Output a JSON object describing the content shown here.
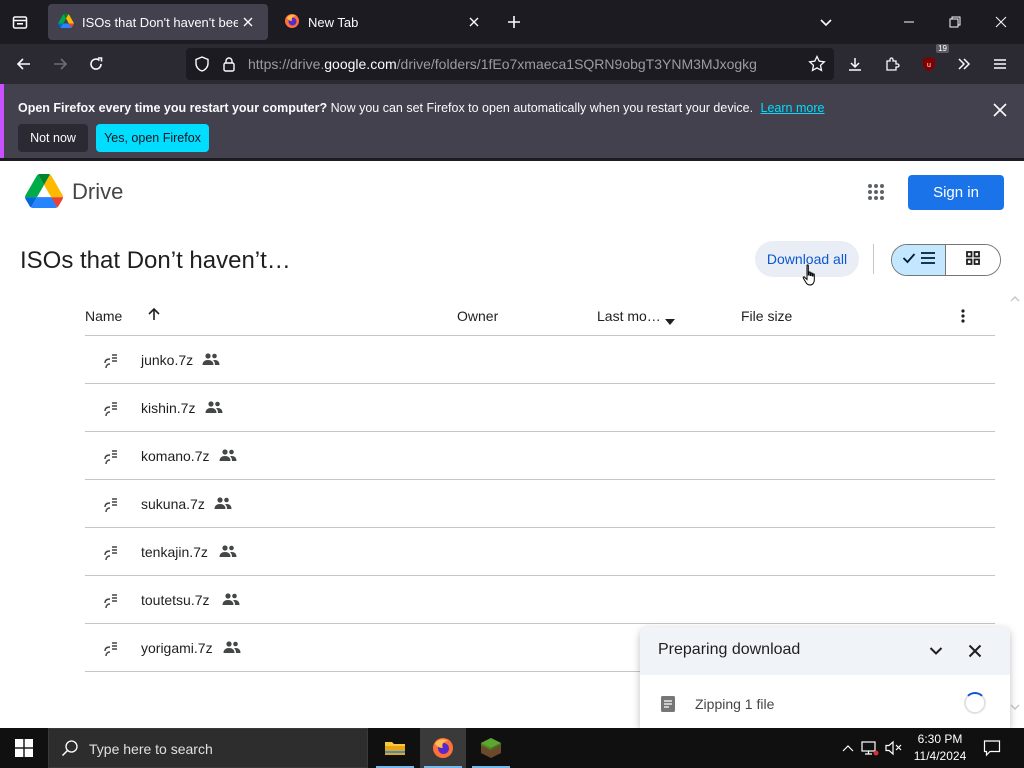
{
  "browser": {
    "tabs": [
      {
        "title": "ISOs that Don't haven't been up",
        "active": true
      },
      {
        "title": "New Tab",
        "active": false
      }
    ],
    "url": {
      "prefix": "https://drive.",
      "host": "google.com",
      "path": "/drive/folders/1fEo7xmaeca1SQRN9obgT3YNM3MJxogkg"
    },
    "extension_badge": "19",
    "notice": {
      "bold": "Open Firefox every time you restart your computer?",
      "text": "Now you can set Firefox to open automatically when you restart your device.",
      "link": "Learn more",
      "not_now": "Not now",
      "yes": "Yes, open Firefox"
    }
  },
  "drive": {
    "brand": "Drive",
    "sign_in": "Sign in",
    "folder_title": "ISOs that Don’t haven’t…",
    "download_all": "Download all",
    "columns": {
      "name": "Name",
      "owner": "Owner",
      "modified": "Last mo…",
      "size": "File size"
    },
    "files": [
      {
        "name": "junko.7z",
        "shared": true
      },
      {
        "name": "kishin.7z",
        "shared": true
      },
      {
        "name": "komano.7z",
        "shared": true
      },
      {
        "name": "sukuna.7z",
        "shared": true
      },
      {
        "name": "tenkajin.7z",
        "shared": true
      },
      {
        "name": "toutetsu.7z",
        "shared": true
      },
      {
        "name": "yorigami.7z",
        "shared": true
      }
    ],
    "download_panel": {
      "title": "Preparing download",
      "item": "Zipping 1 file"
    }
  },
  "taskbar": {
    "search_placeholder": "Type here to search",
    "time": "6:30 PM",
    "date": "11/4/2024"
  },
  "colors": {
    "accent": "#1a73e8",
    "firefox_notice_link": "#00ddff",
    "list_view_selected": "#c2e7ff"
  }
}
